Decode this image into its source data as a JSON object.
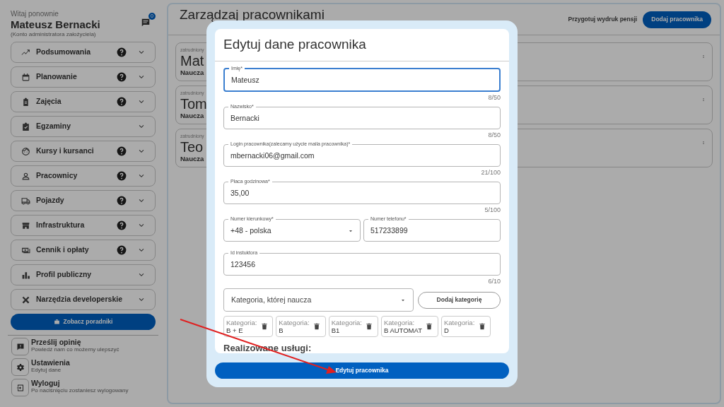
{
  "sidebar": {
    "greeting": "Witaj ponownie",
    "user_name": "Mateusz Bernacki",
    "account_note": "(Konto administratora założyciela)",
    "notification_count": "0",
    "menu": [
      {
        "label": "Podsumowania",
        "help": true
      },
      {
        "label": "Planowanie",
        "help": true
      },
      {
        "label": "Zajęcia",
        "help": true
      },
      {
        "label": "Egzaminy",
        "help": false
      },
      {
        "label": "Kursy i kursanci",
        "help": true
      },
      {
        "label": "Pracownicy",
        "help": true
      },
      {
        "label": "Pojazdy",
        "help": true
      },
      {
        "label": "Infrastruktura",
        "help": true
      },
      {
        "label": "Cennik i opłaty",
        "help": true
      },
      {
        "label": "Profil publiczny",
        "help": false
      },
      {
        "label": "Narzędzia developerskie",
        "help": false
      }
    ],
    "guide_button": "Zobacz poradniki",
    "footer": [
      {
        "title": "Prześlij opinię",
        "subtitle": "Powiedź nam co możemy ulepszyć"
      },
      {
        "title": "Ustawienia",
        "subtitle": "Edytuj dane"
      },
      {
        "title": "Wyloguj",
        "subtitle": "Po naciśnięciu zostaniesz wylogowany"
      }
    ]
  },
  "main": {
    "title": "Zarządzaj pracownikami",
    "print_link": "Przygotuj wydruk pensji",
    "add_button": "Dodaj pracownika",
    "employees": [
      {
        "status": "zatrudniony",
        "name": "Mat",
        "teaches": "Naucza"
      },
      {
        "status": "zatrudniony",
        "name": "Tom",
        "teaches": "Naucza"
      },
      {
        "status": "zatrudniony",
        "name": "Teo",
        "teaches": "Naucza"
      }
    ]
  },
  "dialog": {
    "title": "Edytuj dane pracownika",
    "fields": [
      {
        "kind": "text",
        "label": "Imię*",
        "value": "Mateusz",
        "counter": "8/50",
        "focused": true
      },
      {
        "kind": "text",
        "label": "Nazwisko*",
        "value": "Bernacki",
        "counter": "8/50",
        "focused": false
      },
      {
        "kind": "text",
        "label": "Login pracownika(zalecamy użycie maila pracownika)*",
        "value": "mbernacki06@gmail.com",
        "counter": "21/100",
        "focused": false
      },
      {
        "kind": "text",
        "label": "Płaca godzinowa*",
        "value": "35,00",
        "counter": "5/100",
        "focused": false
      },
      {
        "kind": "pair",
        "fields": [
          {
            "kind": "select",
            "label": "Numer kierunkowy*",
            "value": "+48 - polska",
            "focused": false
          },
          {
            "kind": "text",
            "label": "Numer telefonu*",
            "value": "517233899",
            "focused": false
          }
        ]
      },
      {
        "kind": "text",
        "label": "Id instuktora",
        "value": "123456",
        "counter": "6/10",
        "focused": false
      }
    ],
    "category_select": "Kategoria, której naucza",
    "add_category_button": "Dodaj kategorię",
    "categories": [
      {
        "label": "Kategoria:",
        "value": "B + E"
      },
      {
        "label": "Kategoria:",
        "value": "B"
      },
      {
        "label": "Kategoria:",
        "value": "B1"
      },
      {
        "label": "Kategoria:",
        "value": "B AUTOMAT"
      },
      {
        "label": "Kategoria:",
        "value": "D"
      }
    ],
    "section_heading": "Realizowane usługi:",
    "submit_button": "Edytuj pracownika"
  }
}
